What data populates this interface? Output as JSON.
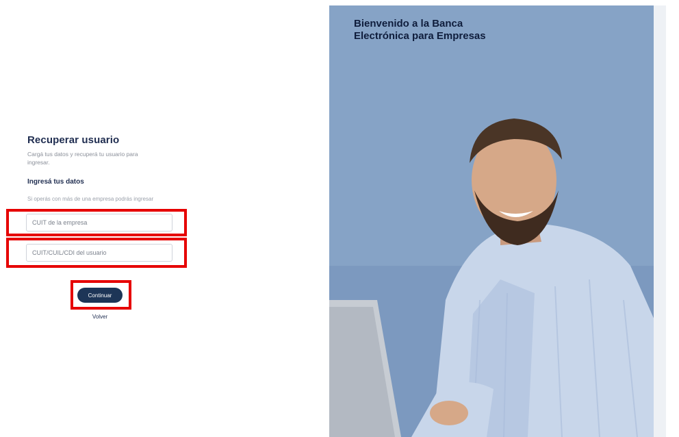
{
  "recover": {
    "title": "Recuperar usuario",
    "subtitle": "Cargá tus datos y recuperá tu usuario para ingresar.",
    "section_title": "Ingresá tus datos",
    "hint": "Si operás con más de una empresa podrás ingresar"
  },
  "fields": {
    "company_cuit_placeholder": "CUIT de la empresa",
    "user_id_placeholder": "CUIT/CUIL/CDI del usuario"
  },
  "actions": {
    "continue_label": "Continuar",
    "back_label": "Volver"
  },
  "hero": {
    "title_line1": "Bienvenido a la Banca",
    "title_line2": "Electrónica para Empresas"
  },
  "colors": {
    "primary": "#1d3557",
    "highlight": "#e60000"
  }
}
